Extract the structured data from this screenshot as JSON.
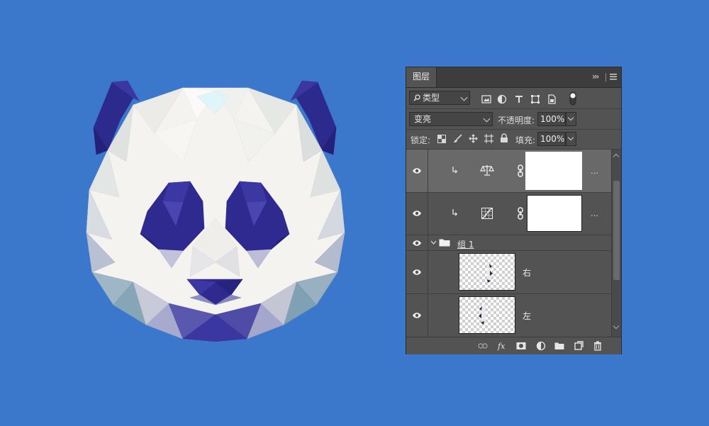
{
  "panel": {
    "tab_title": "图层",
    "filter": {
      "value": "类型"
    },
    "blend_mode": {
      "value": "变亮"
    },
    "opacity": {
      "label": "不透明度:",
      "value": "100%"
    },
    "lock": {
      "label": "锁定:"
    },
    "fill": {
      "label": "填充:",
      "value": "100%"
    }
  },
  "layers": [
    {
      "type": "adjustment",
      "adjustment_icon": "balance-icon",
      "selected": true,
      "mask": "white"
    },
    {
      "type": "adjustment",
      "adjustment_icon": "curves-icon",
      "selected": false,
      "mask": "white"
    },
    {
      "type": "group",
      "name": "组 1",
      "expanded": true
    },
    {
      "type": "pixel",
      "name": "右",
      "thumbnail": "transparent"
    },
    {
      "type": "pixel",
      "name": "左",
      "thumbnail": "transparent"
    }
  ],
  "colors": {
    "background": "#3b78cc",
    "panel": "#535353",
    "panel_dark": "#3d3d3d",
    "selected_row": "#696969",
    "panda_blue": "#2e2a8f",
    "panda_white": "#f6f4f1"
  }
}
